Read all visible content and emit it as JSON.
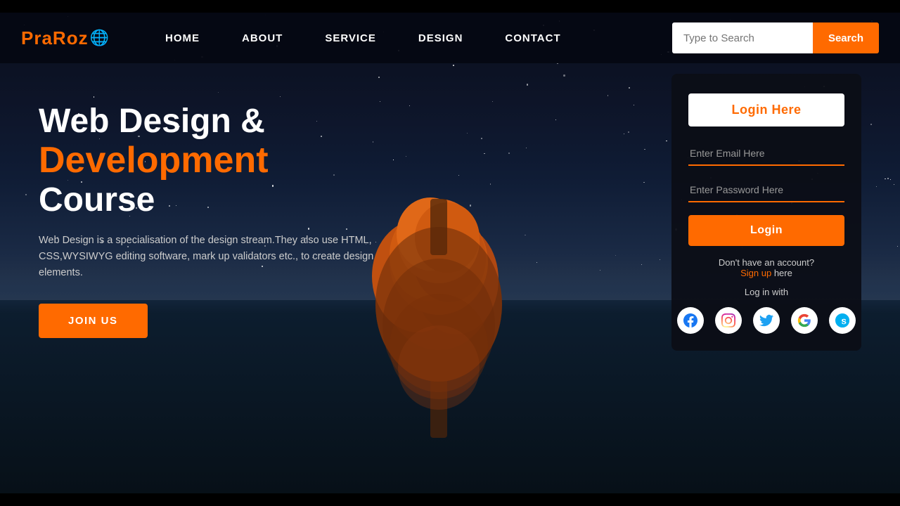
{
  "brand": {
    "name": "PraRoz",
    "globe_icon": "🌐"
  },
  "navbar": {
    "links": [
      {
        "label": "HOME",
        "id": "home"
      },
      {
        "label": "ABOUT",
        "id": "about"
      },
      {
        "label": "SERVICE",
        "id": "service"
      },
      {
        "label": "DESIGN",
        "id": "design"
      },
      {
        "label": "CONTACT",
        "id": "contact"
      }
    ],
    "search_placeholder": "Type to Search",
    "search_button_label": "Search"
  },
  "hero": {
    "line1": "Web Design &",
    "line2": "Development",
    "line3": "Course",
    "description": "Web Design is a specialisation of the design stream.They also use HTML, CSS,WYSIWYG editing software, mark up validators etc., to create design elements.",
    "join_button": "JOIN US"
  },
  "login_card": {
    "title": "Login Here",
    "email_placeholder": "Enter Email Here",
    "password_placeholder": "Enter Password Here",
    "login_button": "Login",
    "no_account_text": "Don't have an account?",
    "signup_label": "Sign up",
    "signup_suffix": " here",
    "login_with_text": "Log in with",
    "social": [
      "facebook",
      "instagram",
      "twitter",
      "google",
      "skype"
    ]
  }
}
